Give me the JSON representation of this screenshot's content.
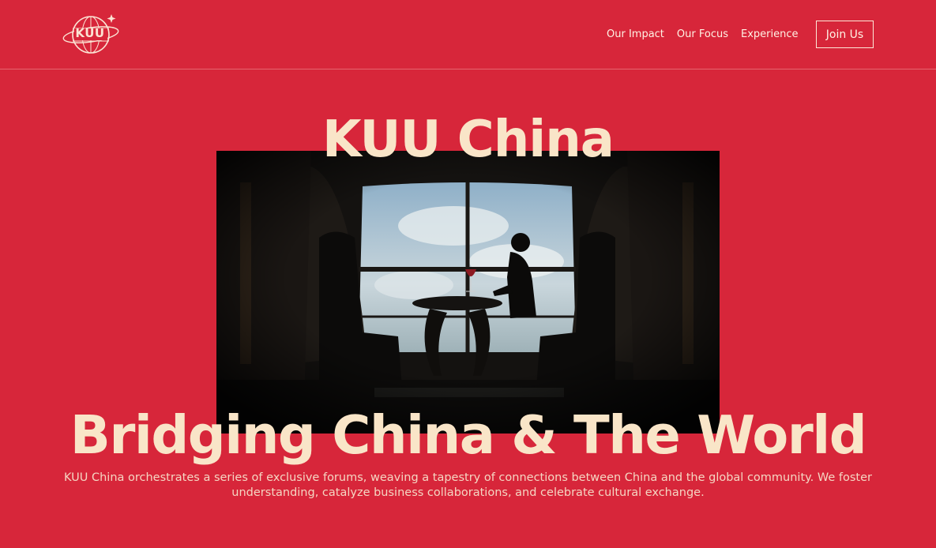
{
  "header": {
    "logo_text": "KUU",
    "nav": [
      "Our Impact",
      "Our Focus",
      "Experience"
    ],
    "cta_label": "Join Us"
  },
  "hero": {
    "title": "KUU China",
    "headline": "Bridging China & The World",
    "description": "KUU China orchestrates a series of exclusive forums, weaving a tapestry of connections between China and the global community. We foster understanding, catalyze business collaborations, and celebrate cultural exchange."
  },
  "colors": {
    "background": "#d7263a",
    "headline": "#f9e5c8",
    "text": "#f5d6c2"
  }
}
